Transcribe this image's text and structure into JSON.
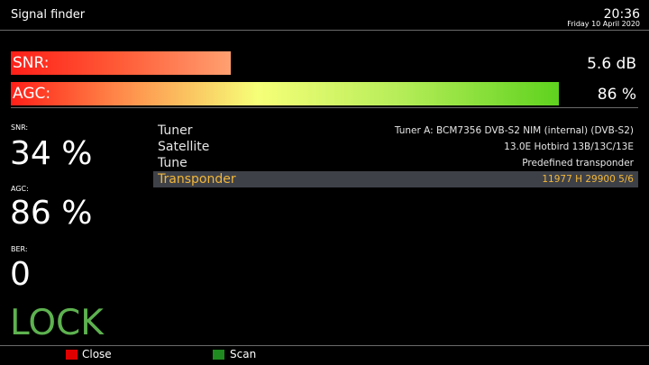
{
  "header": {
    "title": "Signal finder",
    "time": "20:36",
    "date": "Friday 10 April 2020"
  },
  "bars": {
    "snr": {
      "label": "SNR:",
      "value": "5.6 dB",
      "fill_fraction": 0.35,
      "colors": [
        "#ff1f18",
        "#ffa070"
      ]
    },
    "agc": {
      "label": "AGC:",
      "value": "86 %",
      "fill_fraction": 0.873,
      "colors": [
        "#ff1f18",
        "#f6ff78",
        "#5fd21e"
      ]
    }
  },
  "stats": {
    "snr_label": "SNR:",
    "snr_value": "34 %",
    "agc_label": "AGC:",
    "agc_value": "86 %",
    "ber_label": "BER:",
    "ber_value": "0",
    "lock": "LOCK",
    "lock_color": "#5db24f"
  },
  "info_rows": [
    {
      "key": "Tuner",
      "value": "Tuner A: BCM7356 DVB-S2 NIM (internal) (DVB-S2)",
      "selected": false
    },
    {
      "key": "Satellite",
      "value": "13.0E Hotbird 13B/13C/13E",
      "selected": false
    },
    {
      "key": "Tune",
      "value": "Predefined transponder",
      "selected": false
    },
    {
      "key": "Transponder",
      "value": "11977 H 29900 5/6",
      "selected": true
    }
  ],
  "footer": {
    "close": {
      "label": "Close",
      "color": "#e00000"
    },
    "scan": {
      "label": "Scan",
      "color": "#1f8a1f"
    }
  },
  "colors": {
    "selected_text": "#f3b73a",
    "selected_bg": "#3e4148"
  }
}
